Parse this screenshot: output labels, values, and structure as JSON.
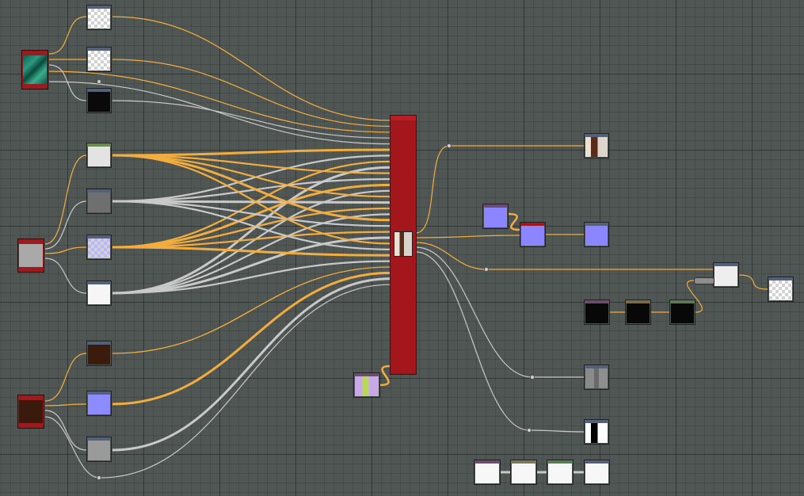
{
  "app": {
    "view": "node-graph"
  },
  "colors": {
    "background": "#505654",
    "grid": "#2a2f2d",
    "wire_color": "#f3ad3e",
    "wire_gray": "#c9c9c9",
    "main_node_red": "#a3161b"
  },
  "nodes": [
    {
      "id": "src-teal",
      "kind": "source",
      "thumbnail": "teal-noise"
    },
    {
      "id": "src-gray",
      "kind": "source",
      "thumbnail": "gray"
    },
    {
      "id": "src-brown",
      "kind": "source",
      "thumbnail": "dark-brown"
    },
    {
      "id": "main-red",
      "kind": "material-output",
      "thumbnail": "red"
    },
    {
      "id": "n-checker-1",
      "thumbnail": "checker"
    },
    {
      "id": "n-checker-2",
      "thumbnail": "checker"
    },
    {
      "id": "n-black-1",
      "thumbnail": "black"
    },
    {
      "id": "n-lightgray",
      "thumbnail": "light-gray"
    },
    {
      "id": "n-gray",
      "thumbnail": "gray"
    },
    {
      "id": "n-lavender",
      "thumbnail": "lavender-checker"
    },
    {
      "id": "n-white",
      "thumbnail": "white"
    },
    {
      "id": "n-brown",
      "thumbnail": "brown"
    },
    {
      "id": "n-blue",
      "thumbnail": "blue"
    },
    {
      "id": "n-gray-2",
      "thumbnail": "gray"
    },
    {
      "id": "n-face-preview",
      "thumbnail": "face"
    },
    {
      "id": "n-blue-a",
      "thumbnail": "normal-blue"
    },
    {
      "id": "n-blue-red",
      "thumbnail": "normal-blue"
    },
    {
      "id": "n-blue-b",
      "thumbnail": "normal-blue"
    },
    {
      "id": "n-white-right",
      "thumbnail": "white"
    },
    {
      "id": "n-checker-right",
      "thumbnail": "checker"
    },
    {
      "id": "n-black-a",
      "thumbnail": "black"
    },
    {
      "id": "n-black-b",
      "thumbnail": "black"
    },
    {
      "id": "n-black-c",
      "thumbnail": "black"
    },
    {
      "id": "n-gray-face",
      "thumbnail": "gray-face"
    },
    {
      "id": "n-bw-face",
      "thumbnail": "bw-face"
    },
    {
      "id": "n-bottom-1",
      "thumbnail": "white"
    },
    {
      "id": "n-bottom-2",
      "thumbnail": "white"
    },
    {
      "id": "n-bottom-3",
      "thumbnail": "white"
    },
    {
      "id": "n-bottom-4",
      "thumbnail": "white"
    },
    {
      "id": "n-yellow-purple",
      "thumbnail": "yellow-purple"
    }
  ],
  "icons": [
    "node-thumbnail",
    "input-port",
    "output-port",
    "reroute-dot"
  ]
}
